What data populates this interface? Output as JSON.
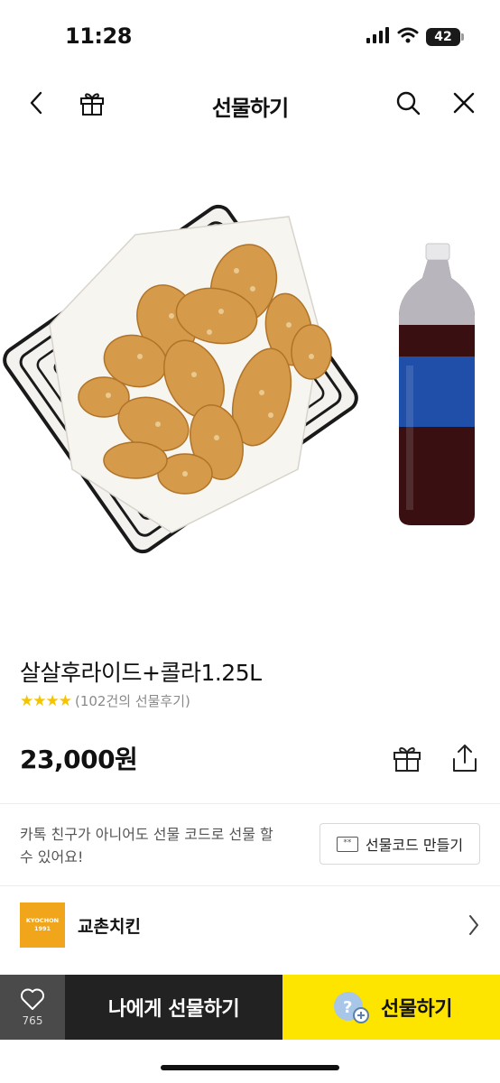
{
  "status_bar": {
    "time": "11:28",
    "battery_level": "42",
    "icons": [
      "signal-icon",
      "wifi-icon",
      "battery-icon"
    ]
  },
  "nav": {
    "title": "선물하기",
    "icons": [
      "back-chevron-icon",
      "gift-box-icon",
      "search-icon",
      "close-icon"
    ]
  },
  "product": {
    "name": "살살후라이드+콜라1.25L",
    "stars": "★★★★",
    "review_count": "(102건의 선물후기)",
    "price": "23,000원",
    "images": [
      "fried-chicken-basket-image",
      "cola-bottle-image"
    ]
  },
  "gift_code": {
    "description": "카톡 친구가 아니어도 선물 코드로 선물 할 수 있어요!",
    "icon_text": "**",
    "button_label": "선물코드 만들기"
  },
  "brand": {
    "logo_line1": "KYOCHON",
    "logo_line2": "1991",
    "name": "교촌치킨"
  },
  "bottom_bar": {
    "like_count": "765",
    "gift_to_me_label": "나에게 선물하기",
    "gift_label": "선물하기"
  },
  "colors": {
    "accent_yellow": "#fee500",
    "star_color": "#f5c400",
    "brand_orange": "#f0a51a",
    "dark_button": "#222222"
  }
}
